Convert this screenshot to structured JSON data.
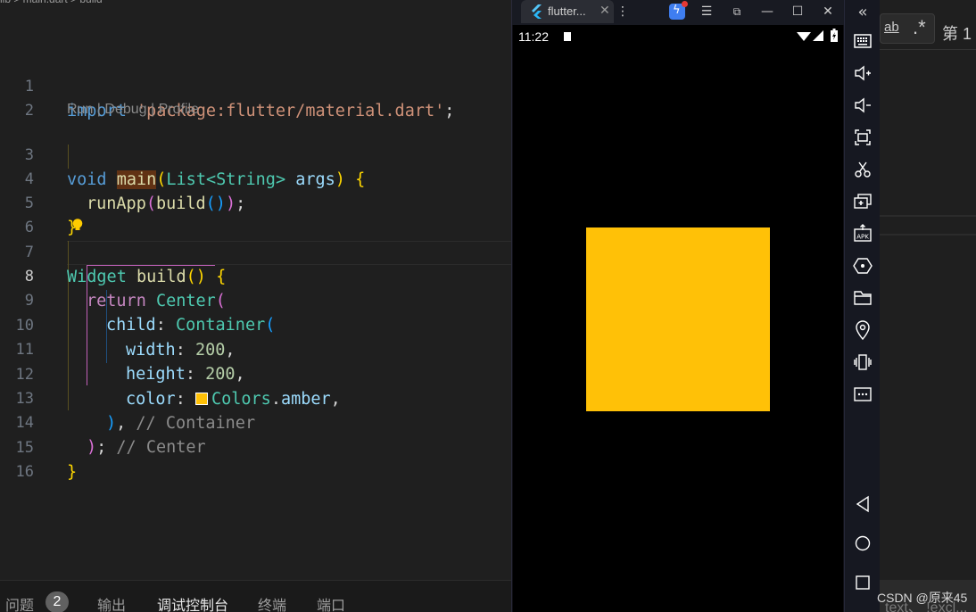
{
  "editor": {
    "breadcrumb": "lib > main.dart > build",
    "codelens": "Run | Debug | Profile",
    "line_numbers": [
      "1",
      "2",
      "3",
      "4",
      "5",
      "6",
      "7",
      "8",
      "9",
      "10",
      "11",
      "12",
      "13",
      "14",
      "15",
      "16"
    ],
    "active_line": "8",
    "lines": {
      "l1": {
        "kw": "import",
        "str": "'package:flutter/material.dart'",
        "end": ";"
      },
      "l3": {
        "ty": "void",
        "fn": "main",
        "p1": "(",
        "ty2": "List",
        "lt": "<",
        "ty3": "String",
        "gt": ">",
        "var": "args",
        "p2": ")",
        "b": "{"
      },
      "l4": {
        "fn": "runApp",
        "p1": "(",
        "fn2": "build",
        "p2": "()",
        "p3": ")",
        "end": ";"
      },
      "l5": {
        "b": "}"
      },
      "l7": {
        "ty": "Widget",
        "fn": "build",
        "p": "()",
        "b": "{"
      },
      "l8": {
        "kw": "return",
        "ty": "Center",
        "p": "("
      },
      "l9": {
        "var": "child",
        "colon": ":",
        "ty": "Container",
        "p": "("
      },
      "l10": {
        "var": "width",
        "colon": ":",
        "num": "200",
        "comma": ","
      },
      "l11": {
        "var": "height",
        "colon": ":",
        "num": "200",
        "comma": ","
      },
      "l12": {
        "var": "color",
        "colon": ":",
        "ty": "Colors",
        "dot": ".",
        "prop": "amber",
        "comma": ","
      },
      "l13": {
        "p": ")",
        "comma": ",",
        "cm": "// Container"
      },
      "l14": {
        "p": ")",
        "end": ";",
        "cm": "// Center"
      },
      "l15": {
        "b": "}"
      }
    },
    "swatch_color": "#ffc107"
  },
  "panel": {
    "tabs": [
      {
        "label": "问题",
        "badge": "2"
      },
      {
        "label": "输出"
      },
      {
        "label": "调试控制台",
        "active": true
      },
      {
        "label": "终端"
      },
      {
        "label": "端口"
      }
    ]
  },
  "emulator": {
    "tab_title": "flutter...",
    "status_time": "11:22",
    "box_color": "#ffc107",
    "toolbar": [
      "keyboard",
      "volume-up",
      "volume-down",
      "screenshot",
      "cut",
      "multi-window",
      "install-apk",
      "settings",
      "folder",
      "location",
      "vibrate",
      "more",
      "back",
      "home",
      "overview"
    ]
  },
  "right_panel": {
    "find_label": "第 1",
    "watermark": "CSDN @原来45",
    "bottom_text": "text、 !excl..."
  }
}
